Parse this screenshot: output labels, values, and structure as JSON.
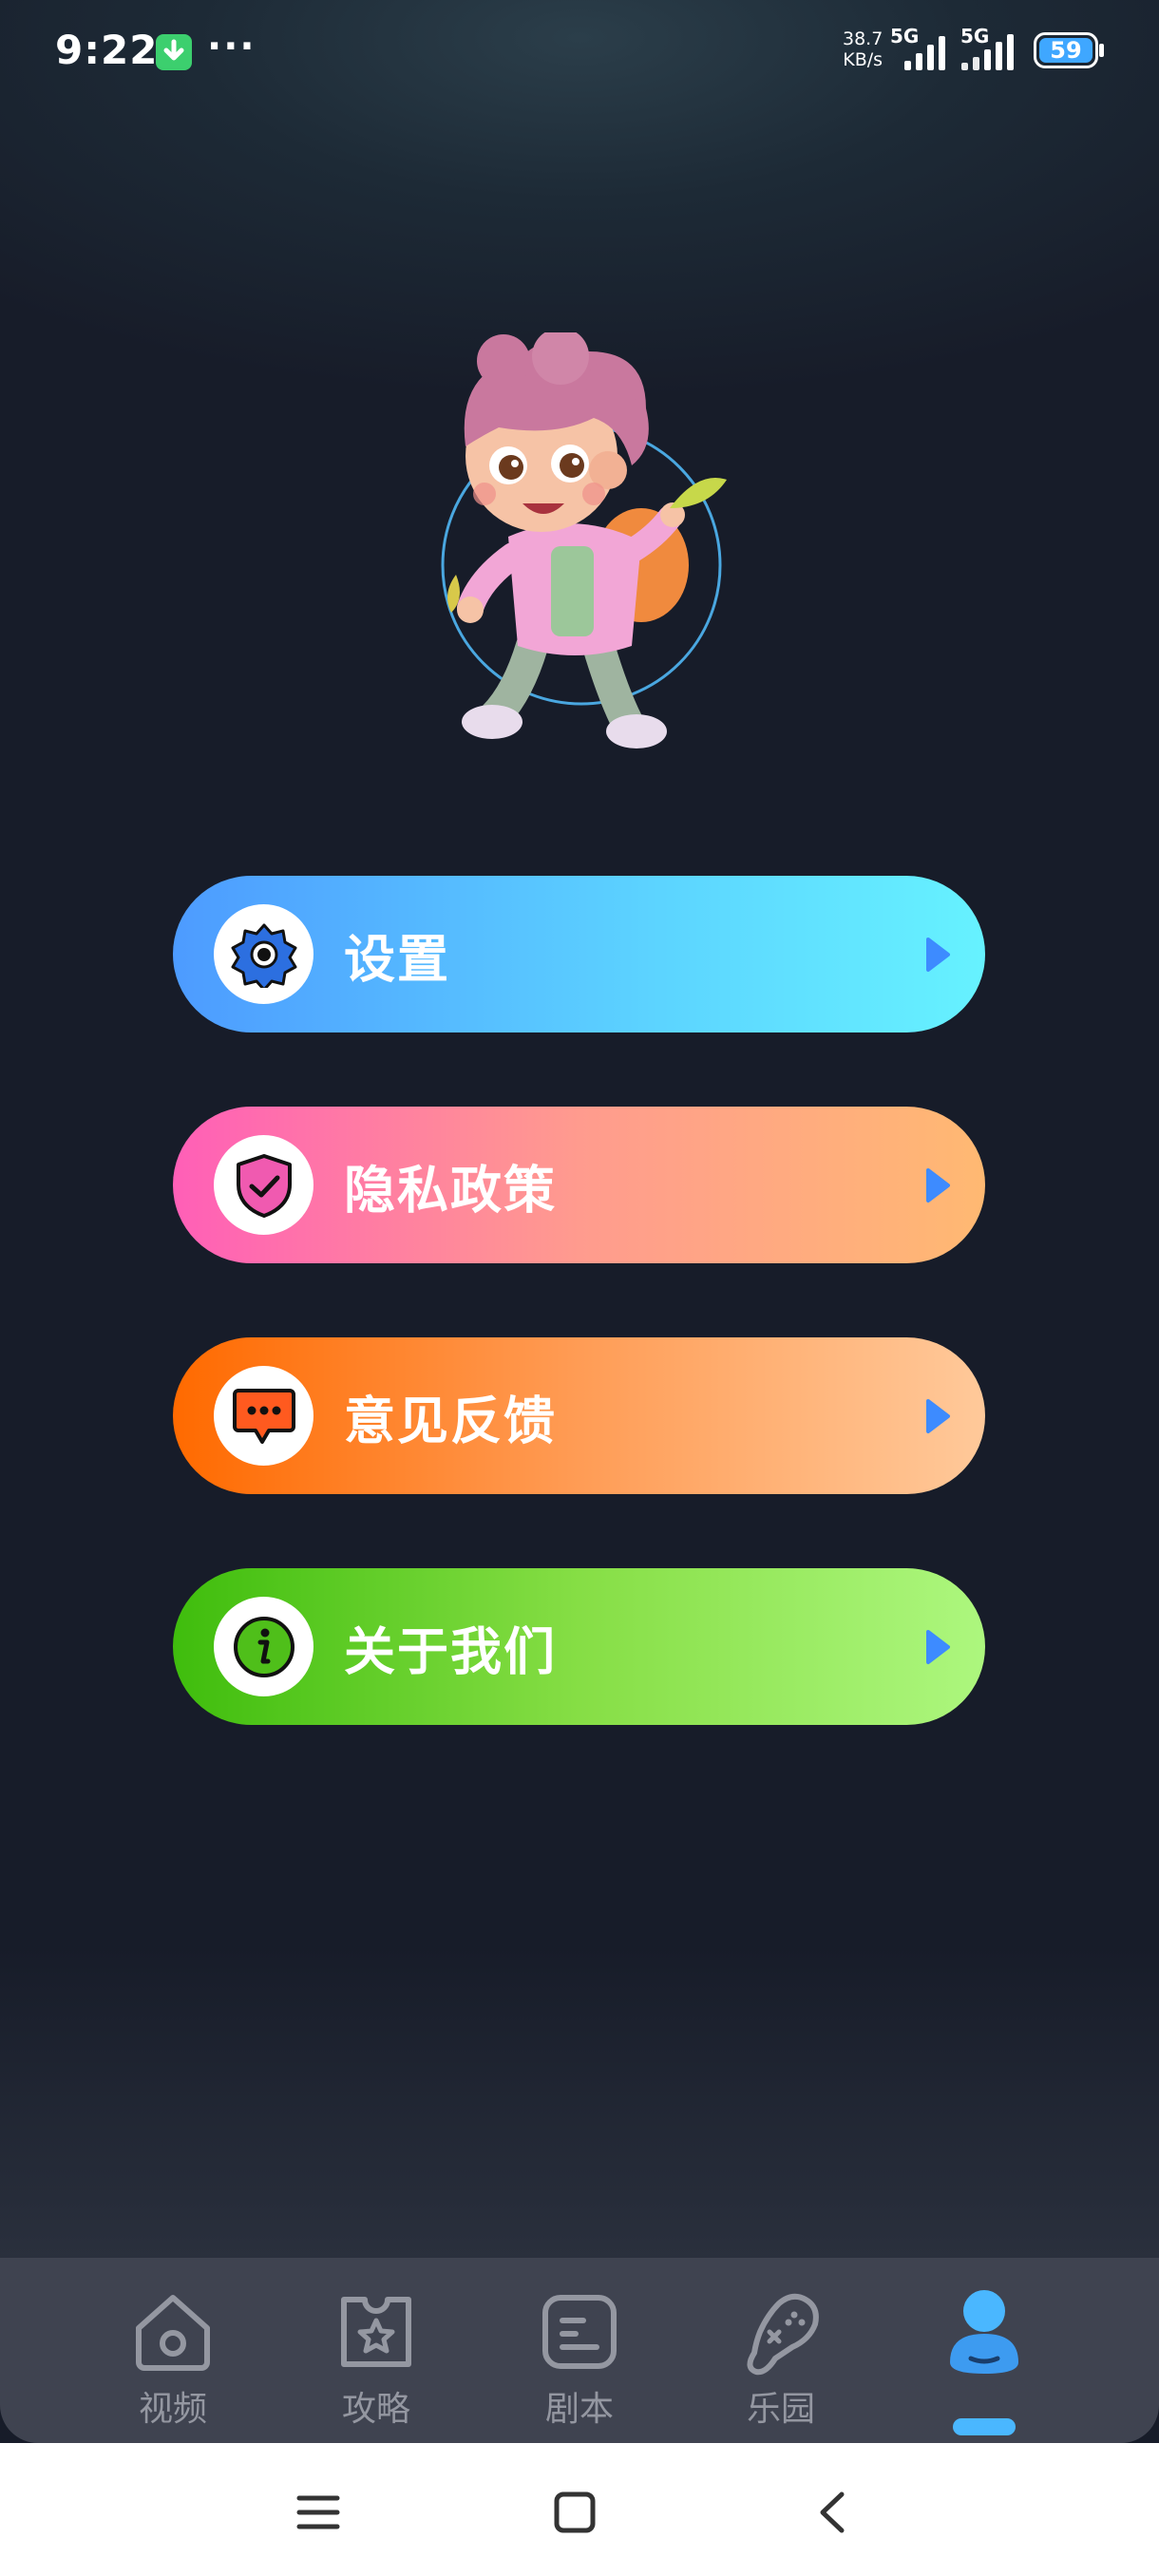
{
  "status_bar": {
    "time": "9:22",
    "more": "···",
    "net_speed_value": "38.7",
    "net_speed_unit": "KB/s",
    "sim1": "5G",
    "sim2": "5G",
    "battery": "59",
    "battery_color": "#3fa7ff",
    "icons": [
      "download-notification-icon",
      "signal-icon",
      "battery-icon"
    ]
  },
  "menu": [
    {
      "label": "设置",
      "icon": "gear-icon",
      "colors": [
        "#4d9bff",
        "#66f2ff"
      ]
    },
    {
      "label": "隐私政策",
      "icon": "shield-check-icon",
      "colors": [
        "#ff5fb7",
        "#ffb972"
      ]
    },
    {
      "label": "意见反馈",
      "icon": "chat-bubble-icon",
      "colors": [
        "#ff6a00",
        "#ffc99a"
      ]
    },
    {
      "label": "关于我们",
      "icon": "info-icon",
      "colors": [
        "#3fbd0d",
        "#adf77e"
      ]
    }
  ],
  "tabs": [
    {
      "label": "视频",
      "icon": "home-icon",
      "active": false
    },
    {
      "label": "攻略",
      "icon": "star-ticket-icon",
      "active": false
    },
    {
      "label": "剧本",
      "icon": "script-icon",
      "active": false
    },
    {
      "label": "乐园",
      "icon": "gamepad-icon",
      "active": false
    },
    {
      "label": "",
      "icon": "profile-icon",
      "active": true
    }
  ],
  "colors": {
    "background": "#171c29",
    "tab_bar": "#3f4350",
    "tab_inactive": "#9497a1",
    "accent": "#4ab7ff"
  }
}
